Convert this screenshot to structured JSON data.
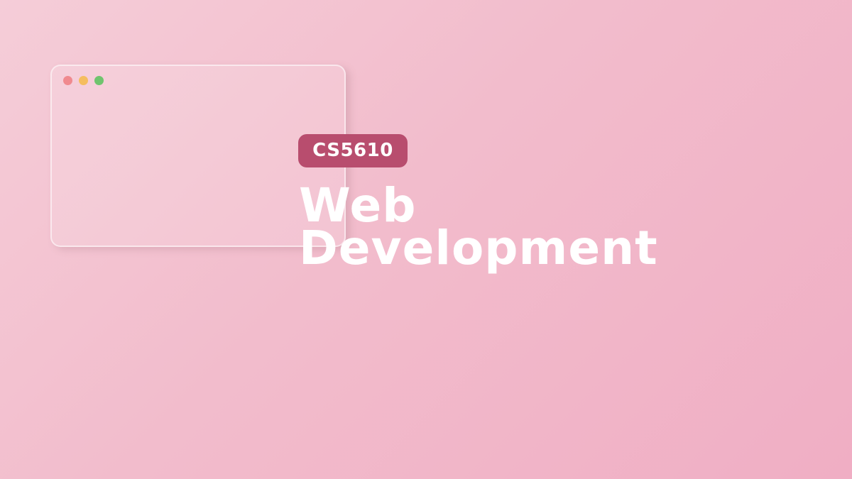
{
  "slide": {
    "badge": "CS5610",
    "title_line1": "Web",
    "title_line2": "Development"
  },
  "window_card": {
    "controls": [
      {
        "name": "close",
        "color": "#f08a8f"
      },
      {
        "name": "minimize",
        "color": "#f5bd5f"
      },
      {
        "name": "maximize",
        "color": "#6fc46e"
      }
    ]
  },
  "colors": {
    "badge_bg": "#b84d6e",
    "title_text": "#ffffff",
    "background_start": "#f5cdd8",
    "background_end": "#f0aec4"
  }
}
